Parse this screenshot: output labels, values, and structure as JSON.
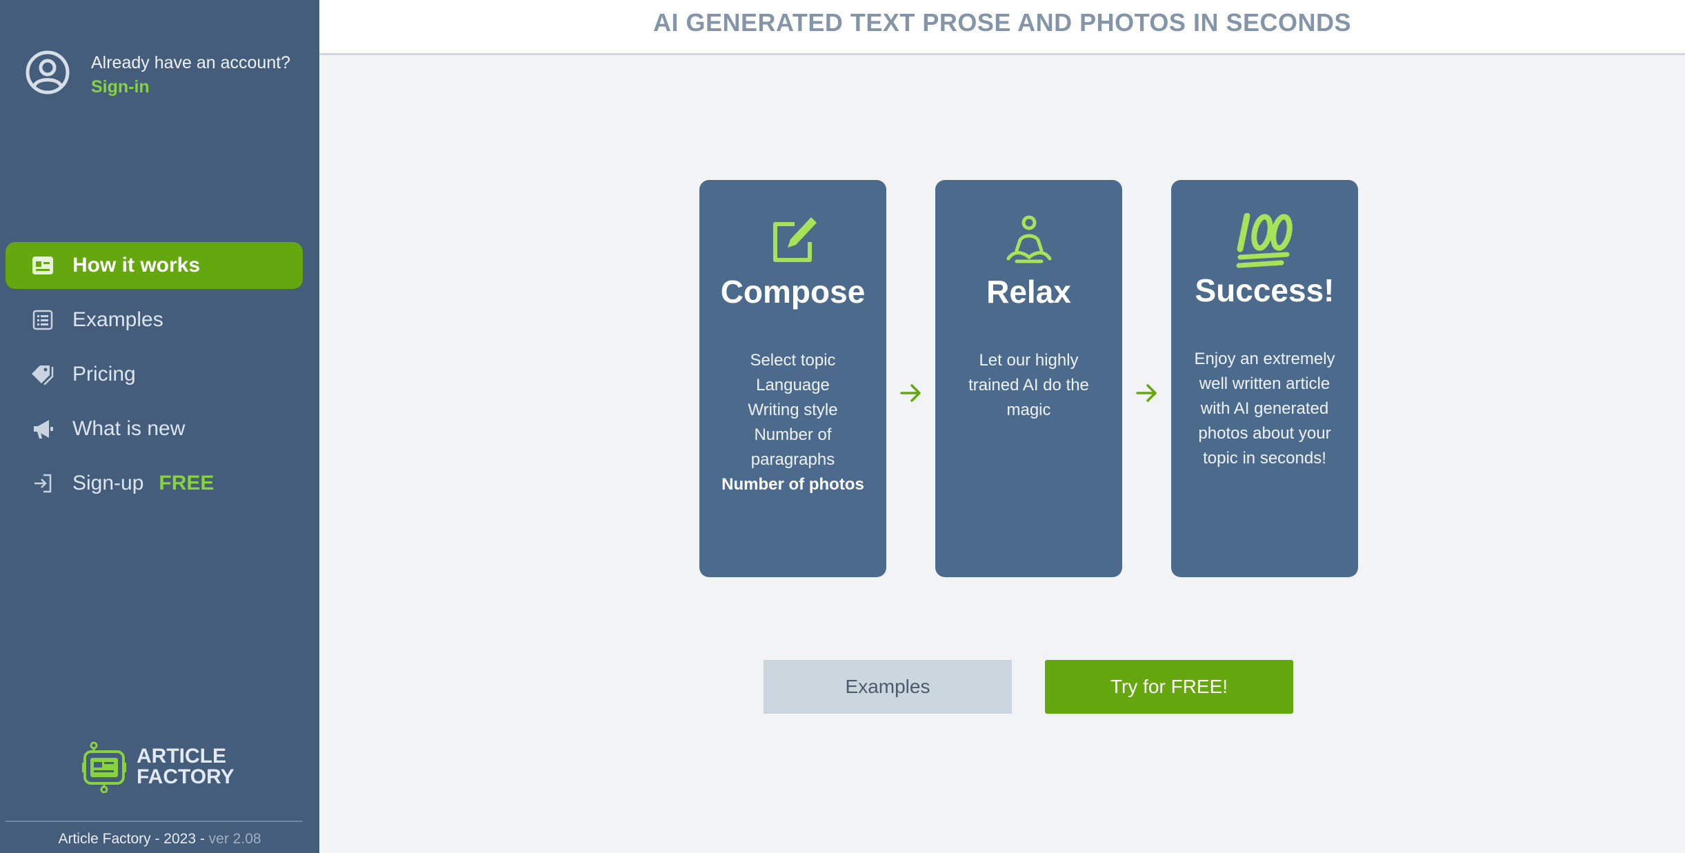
{
  "sidebar": {
    "account": {
      "question": "Already have an account?",
      "signin": "Sign-in"
    },
    "nav": [
      {
        "label": "How it works",
        "icon": "id-card-icon",
        "active": true
      },
      {
        "label": "Examples",
        "icon": "list-icon",
        "active": false
      },
      {
        "label": "Pricing",
        "icon": "tags-icon",
        "active": false
      },
      {
        "label": "What is new",
        "icon": "megaphone-icon",
        "active": false
      },
      {
        "label": "Sign-up",
        "badge": "FREE",
        "icon": "sign-in-icon",
        "active": false
      }
    ],
    "brand": {
      "line1": "ARTICLE",
      "line2": "FACTORY"
    },
    "footer": {
      "text": "Article Factory - 2023 - ",
      "version": "ver 2.08"
    }
  },
  "header": {
    "title": "AI GENERATED TEXT PROSE AND PHOTOS IN SECONDS"
  },
  "steps": [
    {
      "icon": "edit-icon",
      "title": "Compose",
      "lines": [
        "Select topic",
        "Language",
        "Writing style",
        "Number of paragraphs"
      ],
      "bold": "Number of photos"
    },
    {
      "icon": "meditation-icon",
      "title": "Relax",
      "text": "Let our highly trained AI do the magic"
    },
    {
      "icon": "hundred-icon",
      "title": "Success!",
      "text": "Enjoy an extremely well written article with AI generated photos about your topic in seconds!"
    }
  ],
  "buttons": {
    "examples": "Examples",
    "try": "Try for FREE!"
  },
  "colors": {
    "sidebar": "#435d7b",
    "accent": "#64a70e",
    "accent_text": "#88d13f",
    "card": "#4c6a8c",
    "background": "#f1f3f5"
  }
}
